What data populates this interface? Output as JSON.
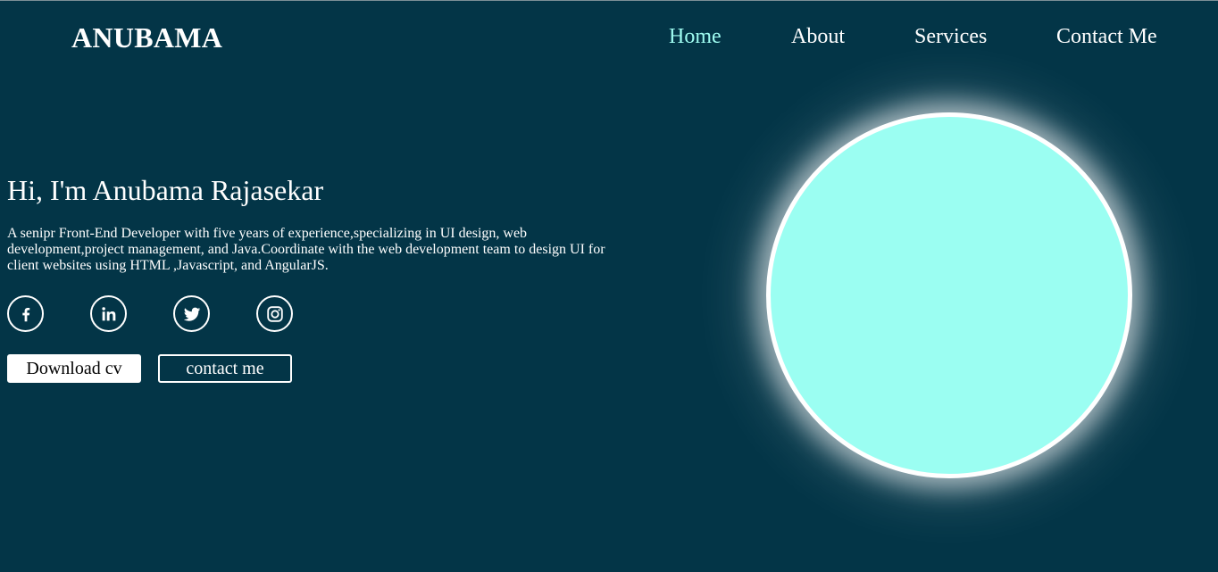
{
  "brand": {
    "logo": "ANUBAMA"
  },
  "nav": {
    "items": [
      {
        "label": "Home",
        "active": true
      },
      {
        "label": "About",
        "active": false
      },
      {
        "label": "Services",
        "active": false
      },
      {
        "label": "Contact Me",
        "active": false
      }
    ]
  },
  "hero": {
    "title": "Hi, I'm Anubama Rajasekar",
    "description": "A senipr Front-End Developer with five years of experience,specializing in UI design, web development,project management, and Java.Coordinate with the web development team to design UI for client websites using HTML ,Javascript, and AngularJS.",
    "social": [
      {
        "icon": "facebook-icon"
      },
      {
        "icon": "linkedin-icon"
      },
      {
        "icon": "twitter-icon"
      },
      {
        "icon": "instagram-icon"
      }
    ],
    "buttons": {
      "download": "Download cv",
      "contact": "contact me"
    }
  },
  "colors": {
    "background": "#033547",
    "accent": "#9ffcf1",
    "circle_fill": "#9bfef2",
    "text": "#ffffff"
  }
}
